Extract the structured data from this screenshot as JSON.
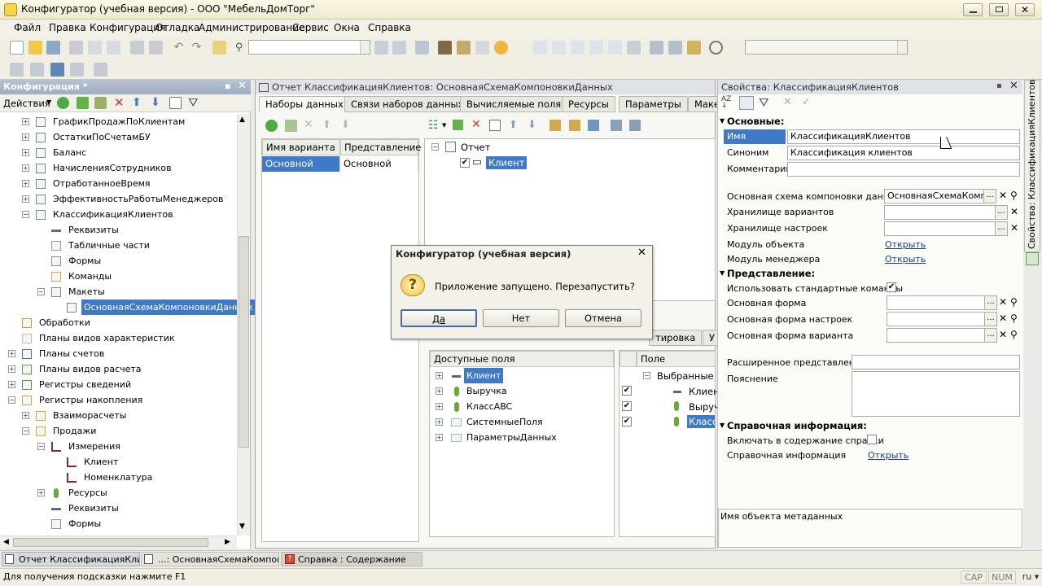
{
  "window": {
    "title": "Конфигуратор (учебная версия) - ООО \"МебельДомТорг\""
  },
  "menu": [
    "Файл",
    "Правка",
    "Конфигурация",
    "Отладка",
    "Администрирование",
    "Сервис",
    "Окна",
    "Справка"
  ],
  "config_panel": {
    "title": "Конфигурация *",
    "actions_label": "Действия",
    "tree": [
      {
        "label": "ГрафикПродажПоКлиентам",
        "level": 1,
        "exp": "+",
        "icon": "report-icon"
      },
      {
        "label": "ОстаткиПоСчетамБУ",
        "level": 1,
        "exp": "+",
        "icon": "report-icon"
      },
      {
        "label": "Баланс",
        "level": 1,
        "exp": "+",
        "icon": "report-icon"
      },
      {
        "label": "НачисленияСотрудников",
        "level": 1,
        "exp": "+",
        "icon": "report-icon"
      },
      {
        "label": "ОтработанноеВремя",
        "level": 1,
        "exp": "+",
        "icon": "report-icon"
      },
      {
        "label": "ЭффективностьРаботыМенеджеров",
        "level": 1,
        "exp": "+",
        "icon": "report-icon"
      },
      {
        "label": "КлассификацияКлиентов",
        "level": 1,
        "exp": "-",
        "icon": "report-icon"
      },
      {
        "label": "Реквизиты",
        "level": 2,
        "exp": "",
        "icon": "attribute-icon"
      },
      {
        "label": "Табличные части",
        "level": 2,
        "exp": "",
        "icon": "table-icon"
      },
      {
        "label": "Формы",
        "level": 2,
        "exp": "",
        "icon": "form-icon"
      },
      {
        "label": "Команды",
        "level": 2,
        "exp": "",
        "icon": "command-icon"
      },
      {
        "label": "Макеты",
        "level": 2,
        "exp": "-",
        "icon": "template-icon"
      },
      {
        "label": "ОсновнаяСхемаКомпоновкиДанных",
        "level": 3,
        "exp": "",
        "icon": "template-icon",
        "selected": true
      },
      {
        "label": "Обработки",
        "level": 0,
        "exp": "",
        "icon": "processing-icon"
      },
      {
        "label": "Планы видов характеристик",
        "level": 0,
        "exp": "",
        "icon": "chart-of-characteristics-icon"
      },
      {
        "label": "Планы счетов",
        "level": 0,
        "exp": "+",
        "icon": "chart-of-accounts-icon"
      },
      {
        "label": "Планы видов расчета",
        "level": 0,
        "exp": "+",
        "icon": "calculation-types-icon"
      },
      {
        "label": "Регистры сведений",
        "level": 0,
        "exp": "+",
        "icon": "information-register-icon"
      },
      {
        "label": "Регистры накопления",
        "level": 0,
        "exp": "-",
        "icon": "accumulation-register-icon"
      },
      {
        "label": "Взаиморасчеты",
        "level": 1,
        "exp": "+",
        "icon": "accumulation-register-icon"
      },
      {
        "label": "Продажи",
        "level": 1,
        "exp": "-",
        "icon": "accumulation-register-icon"
      },
      {
        "label": "Измерения",
        "level": 2,
        "exp": "-",
        "icon": "dimension-icon"
      },
      {
        "label": "Клиент",
        "level": 3,
        "exp": "",
        "icon": "dimension-icon"
      },
      {
        "label": "Номенклатура",
        "level": 3,
        "exp": "",
        "icon": "dimension-icon"
      },
      {
        "label": "Ресурсы",
        "level": 2,
        "exp": "+",
        "icon": "resource-icon"
      },
      {
        "label": "Реквизиты",
        "level": 2,
        "exp": "",
        "icon": "attribute-icon"
      },
      {
        "label": "Формы",
        "level": 2,
        "exp": "",
        "icon": "form-icon"
      }
    ]
  },
  "report_window": {
    "title": "Отчет КлассификацияКлиентов: ОсновнаяСхемаКомпоновкиДанных",
    "tabs": [
      "Наборы данных",
      "Связи наборов данных",
      "Вычисляемые поля",
      "Ресурсы",
      "Параметры",
      "Маке"
    ],
    "variants_headers": [
      "Имя варианта",
      "Представление"
    ],
    "variants_rows": [
      [
        "Основной",
        "Основной"
      ]
    ],
    "structure": [
      "Отчет",
      "Клиент"
    ],
    "lower_tabs": [
      "тировка",
      "У"
    ],
    "available_fields_header": "Доступные поля",
    "available_fields": [
      "Клиент",
      "Выручка",
      "КлассABC",
      "СистемныеПоля",
      "ПараметрыДанных"
    ],
    "fields_header": "Поле",
    "selected_fields": [
      "Выбранные по",
      "Клиен",
      "Выруч",
      "Класс"
    ]
  },
  "properties": {
    "title": "Свойства: КлассификацияКлиентов",
    "vertical_tab": "Свойства: КлассификацияКлиентов",
    "sections": {
      "main": "Основные:",
      "presentation": "Представление:",
      "help": "Справочная информация:"
    },
    "name_label": "Имя",
    "name_value": "КлассификацияКлиентов",
    "synonym_label": "Синоним",
    "synonym_value": "Классификация клиентов",
    "comment_label": "Комментарий",
    "main_dcs_label": "Основная схема компоновки данных",
    "main_dcs_value": "ОсновнаяСхемаКомпон",
    "variants_storage_label": "Хранилище вариантов",
    "settings_storage_label": "Хранилище настроек",
    "object_module_label": "Модуль объекта",
    "manager_module_label": "Модуль менеджера",
    "open_link": "Открыть",
    "use_std_commands_label": "Использовать стандартные команды",
    "main_form_label": "Основная форма",
    "settings_form_label": "Основная форма настроек",
    "variant_form_label": "Основная форма варианта",
    "ext_presentation_label": "Расширенное представление",
    "explanation_label": "Пояснение",
    "include_help_label": "Включать в содержание справки",
    "help_info_label": "Справочная информация",
    "description": "Имя объекта метаданных"
  },
  "dialog": {
    "title": "Конфигуратор (учебная версия)",
    "message": "Приложение запущено. Перезапустить?",
    "buttons": [
      "Да",
      "Нет",
      "Отмена"
    ]
  },
  "taskbar": [
    "Отчет КлассификацияКлие...",
    "...: ОсновнаяСхемаКомпон...",
    "Справка : Содержание"
  ],
  "status": {
    "hint": "Для получения подсказки нажмите F1",
    "cap": "CAP",
    "num": "NUM",
    "lang": "ru"
  }
}
